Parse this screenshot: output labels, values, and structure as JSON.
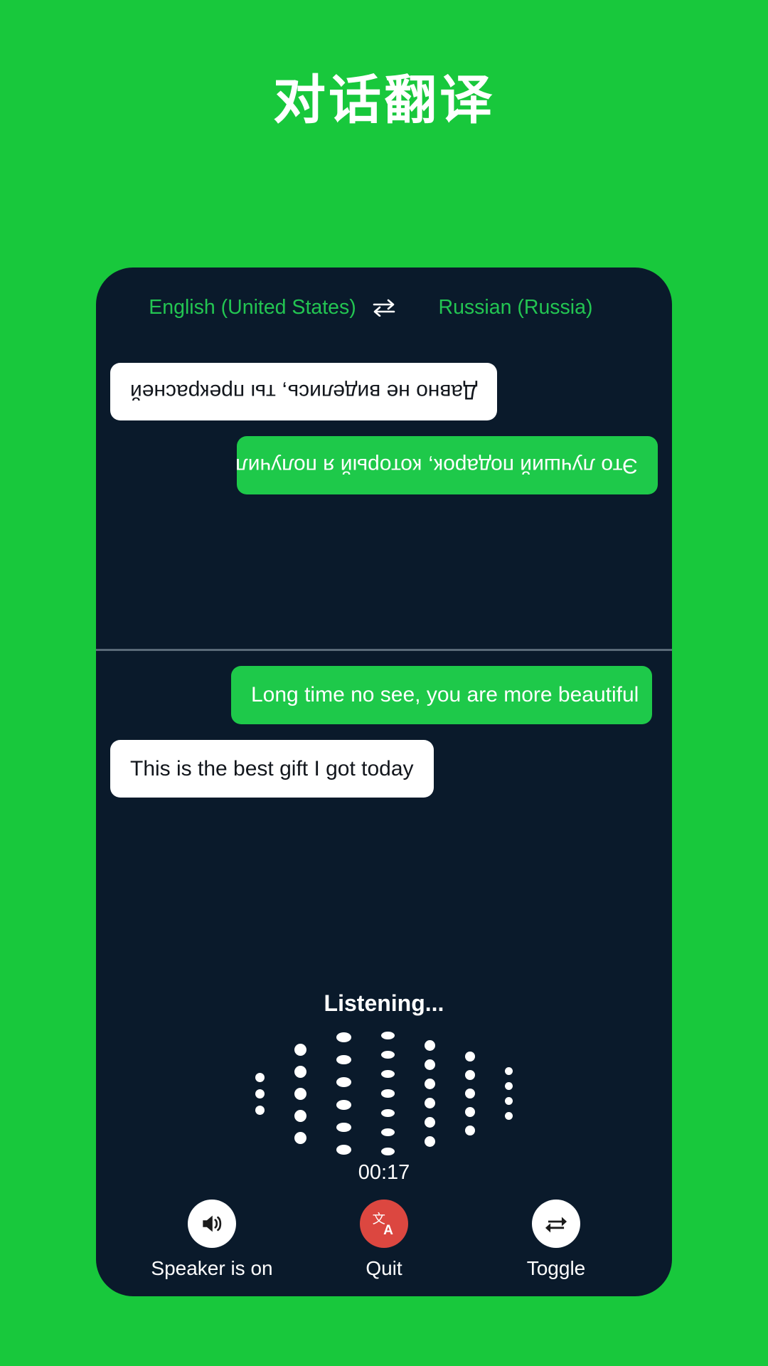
{
  "page": {
    "title": "对话翻译",
    "background_color": "#18c83c",
    "card_color": "#0a1a2b"
  },
  "language_bar": {
    "source": "English (United States)",
    "swap_icon": "swap-horizontal-icon",
    "swap_glyph": "⇌",
    "target": "Russian (Russia)",
    "text_color": "#23c552"
  },
  "conversation": {
    "top_pane": {
      "rotated": true,
      "messages": [
        {
          "text": "Это лучший подарок, который я получил сегодня",
          "style": "green",
          "align": "left"
        },
        {
          "text": "Давно не виделись, ты прекрасней",
          "style": "white",
          "align": "right"
        }
      ]
    },
    "bottom_pane": {
      "rotated": false,
      "messages": [
        {
          "text": "Long time no see, you are more beautiful",
          "style": "green",
          "align": "right"
        },
        {
          "text": "This is the best gift I got today",
          "style": "white",
          "align": "left"
        }
      ]
    },
    "bubble_green_color": "#1ec94a",
    "bubble_white_color": "#ffffff"
  },
  "listening": {
    "label": "Listening...",
    "timer": "00:17",
    "waveform": {
      "columns": [
        {
          "dots": 3,
          "size": 13
        },
        {
          "dots": 5,
          "size": 17
        },
        {
          "dots": 6,
          "size": 21
        },
        {
          "dots": 7,
          "size": 19
        },
        {
          "dots": 6,
          "size": 15
        },
        {
          "dots": 5,
          "size": 14
        },
        {
          "dots": 4,
          "size": 11
        }
      ],
      "dot_color": "#ffffff"
    }
  },
  "controls": [
    {
      "icon": "speaker-on-icon",
      "label": "Speaker is on",
      "bg": "#ffffff"
    },
    {
      "icon": "translate-quit-icon",
      "label": "Quit",
      "bg": "#dc4740"
    },
    {
      "icon": "toggle-swap-icon",
      "label": "Toggle",
      "bg": "#ffffff"
    }
  ]
}
